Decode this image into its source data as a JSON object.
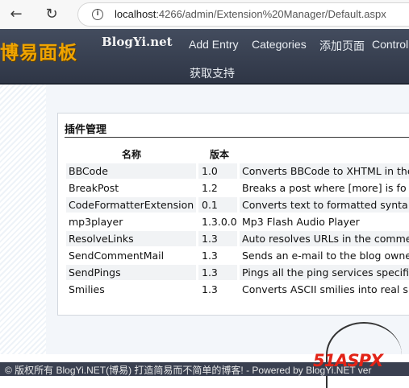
{
  "browser": {
    "back_icon": "←",
    "reload_icon": "↻",
    "info_icon": "i",
    "url_host": "localhost",
    "url_rest": ":4266/admin/Extension%20Manager/Default.aspx"
  },
  "site": {
    "logo_cn": "博易面板",
    "logo_en": "BlogYi.net",
    "menu": [
      "Add Entry",
      "Categories",
      "添加页面",
      "Control",
      "获取支持"
    ]
  },
  "panel": {
    "title": "插件管理",
    "headers": [
      "名称",
      "版本"
    ],
    "rows": [
      [
        "BBCode",
        "1.0",
        "Converts BBCode to XHTML in the"
      ],
      [
        "BreakPost",
        "1.2",
        "Breaks a post where [more] is fo"
      ],
      [
        "CodeFormatterExtension",
        "0.1",
        "Converts text to formatted synta"
      ],
      [
        "mp3player",
        "1.3.0.0",
        "Mp3 Flash Audio Player"
      ],
      [
        "ResolveLinks",
        "1.3",
        "Auto resolves URLs in the comme"
      ],
      [
        "SendCommentMail",
        "1.3",
        "Sends an e-mail to the blog owne"
      ],
      [
        "SendPings",
        "1.3",
        "Pings all the ping services specifi"
      ],
      [
        "Smilies",
        "1.3",
        "Converts ASCII smilies into real s"
      ]
    ]
  },
  "watermark": {
    "text": "51ASPX"
  },
  "footer": {
    "text": "© 版权所有 BlogYi.NET(博易) 打造简易而不简单的博客! - Powered by BlogYi.NET ver"
  }
}
